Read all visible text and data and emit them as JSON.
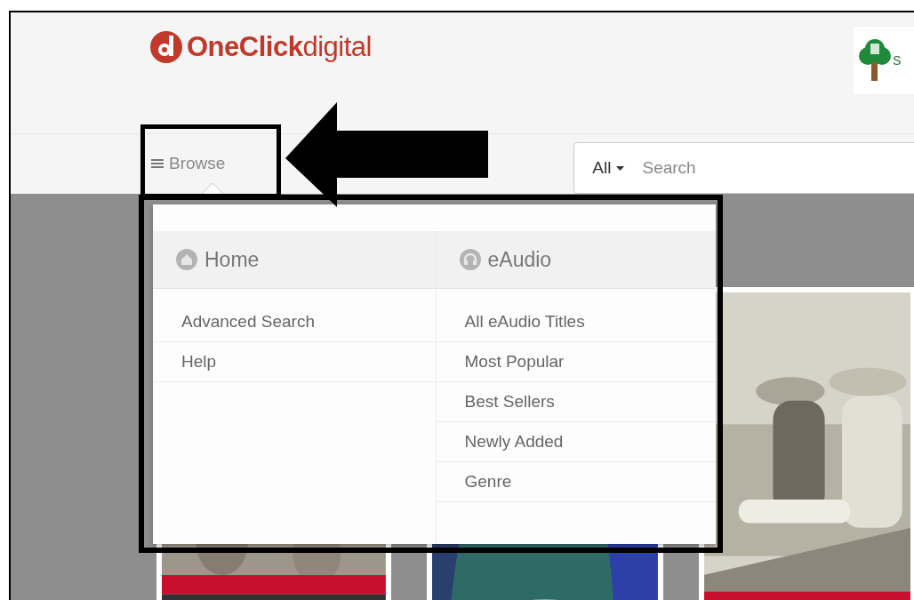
{
  "header": {
    "logo": "**OneClick**digital",
    "library_logo": "S"
  },
  "browse": {
    "label": "Browse",
    "expanded": true
  },
  "search": {
    "scope": "All",
    "placeholder": "Search"
  },
  "menu": {
    "columns": [
      {
        "title": "Home",
        "kind": "home",
        "items": [
          "Advanced Search",
          "Help"
        ]
      },
      {
        "title": "eAudio",
        "kind": "audio",
        "items": [
          "All eAudio Titles",
          "Most Popular",
          "Best Sellers",
          "Newly Added",
          "Genre"
        ]
      }
    ]
  },
  "annotations": [
    {
      "kind": "box"
    },
    {
      "kind": "arrow"
    },
    {
      "kind": "box"
    }
  ]
}
